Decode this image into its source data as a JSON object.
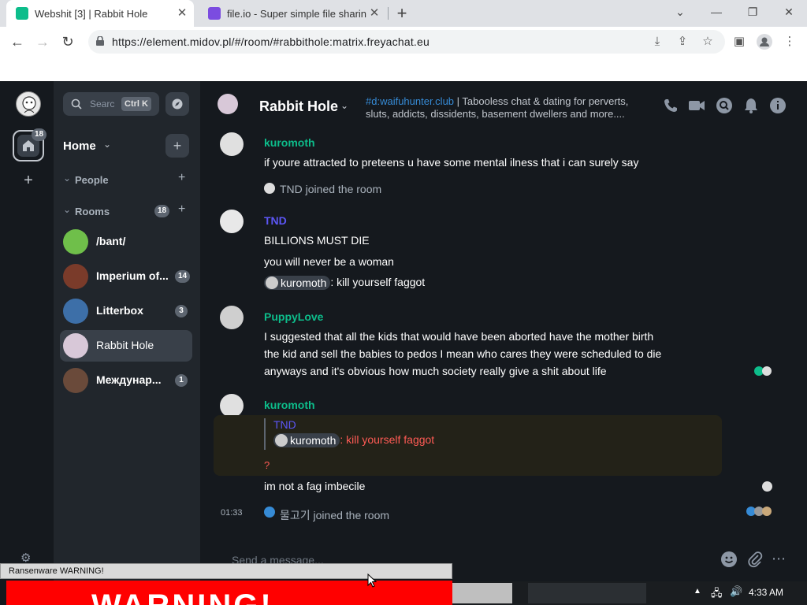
{
  "browser": {
    "tabs": [
      {
        "title": "Webshit [3] | Rabbit Hole",
        "active": true,
        "favicon_color": "#0dbd8b"
      },
      {
        "title": "file.io - Super simple file sharin",
        "active": false,
        "favicon_color": "#7b4ce0"
      }
    ],
    "url": "https://element.midov.pl/#/room/#rabbithole:matrix.freyachat.eu",
    "new_tab_symbol": "+"
  },
  "spaces": {
    "home_badge": "18",
    "add_symbol": "+"
  },
  "roomlist": {
    "search_placeholder": "Searc",
    "search_shortcut": "Ctrl K",
    "home_label": "Home",
    "people_label": "People",
    "rooms_label": "Rooms",
    "rooms_count": "18",
    "rooms": [
      {
        "name": "/bant/",
        "badge": "",
        "color": "#6fbf4a",
        "selected": false
      },
      {
        "name": "Imperium of...",
        "badge": "14",
        "color": "#7a3b2a",
        "selected": false
      },
      {
        "name": "Litterbox",
        "badge": "3",
        "color": "#3d6fa8",
        "selected": false
      },
      {
        "name": "Rabbit Hole",
        "badge": "",
        "color": "#d8c8d8",
        "selected": true
      },
      {
        "name": "Междунар...",
        "badge": "1",
        "color": "#6a4a3a",
        "selected": false
      }
    ]
  },
  "room": {
    "name": "Rabbit Hole",
    "topic_link": "#d:waifuhunter.club",
    "topic_line1": " | Tabooless chat & dating for perverts,",
    "topic_line2": "sluts, addicts, dissidents, basement dwellers and more...."
  },
  "timeline": {
    "m1_sender": "kuromoth",
    "m1_text": "if youre attracted to preteens u have some mental ilness that i can surely say",
    "e1_text": "TND joined the room",
    "m2_sender": "TND",
    "m2_line1": "BILLIONS MUST DIE",
    "m2_line2": "you will never be a woman",
    "m2_pill": "kuromoth",
    "m2_line3": ": kill yourself faggot",
    "m3_sender": "PuppyLove",
    "m3_line1": "I suggested that all the kids that would have been aborted have the mother birth",
    "m3_line2": "the kid and sell the babies to pedos I mean who cares they were scheduled to die",
    "m3_line3": "anyways and it's obvious how much society really give a shit about life",
    "m4_sender": "kuromoth",
    "m4_quote_sender": "TND",
    "m4_quote_pill": "kuromoth",
    "m4_quote_text": ": kill yourself faggot",
    "m4_q": "?",
    "m4_text": "im not a fag imbecile",
    "e2_time": "01:33",
    "e2_text": "물고기 joined the room"
  },
  "composer": {
    "placeholder": "Send a message..."
  },
  "overlay": {
    "warning_title": "Ransenware WARNING!",
    "warning_big": "WARNING!"
  },
  "taskbar": {
    "time": "4:33 AM"
  },
  "colors": {
    "accent_green": "#0dbd8b",
    "sender_tnd": "#5c56f5",
    "sender_teal": "#0dbd8b",
    "quote_red": "#ff5b55",
    "link_blue": "#368bd6"
  }
}
